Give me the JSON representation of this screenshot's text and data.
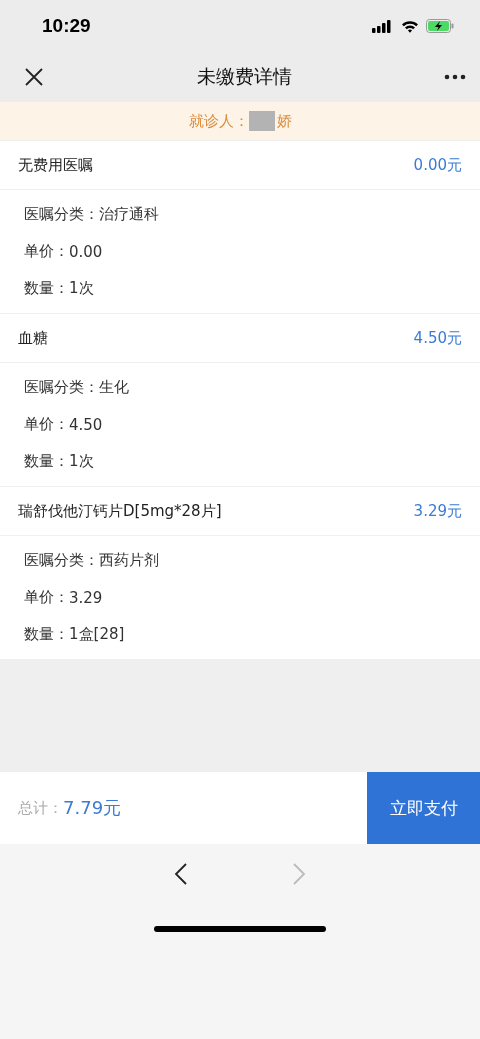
{
  "status_bar": {
    "time": "10:29"
  },
  "nav": {
    "title": "未缴费详情"
  },
  "patient": {
    "label": "就诊人：",
    "name": "娇"
  },
  "items": [
    {
      "name": "无费用医嘱",
      "amount": "0.00元",
      "details": [
        {
          "label": "医嘱分类：",
          "value": "治疗通科"
        },
        {
          "label": "单价：",
          "value": "0.00"
        },
        {
          "label": "数量：",
          "value": "1次"
        }
      ]
    },
    {
      "name": "血糖",
      "amount": "4.50元",
      "details": [
        {
          "label": "医嘱分类：",
          "value": "生化"
        },
        {
          "label": "单价：",
          "value": "4.50"
        },
        {
          "label": "数量：",
          "value": "1次"
        }
      ]
    },
    {
      "name": "瑞舒伐他汀钙片D[5mg*28片]",
      "amount": "3.29元",
      "details": [
        {
          "label": "医嘱分类：",
          "value": "西药片剂"
        },
        {
          "label": "单价：",
          "value": "3.29"
        },
        {
          "label": "数量：",
          "value": "1盒[28]"
        }
      ]
    }
  ],
  "footer": {
    "total_label": "总计：",
    "total": "7.79元",
    "pay_button": "立即支付"
  },
  "browser_nav": {
    "back": {
      "disabled": false
    },
    "forward": {
      "disabled": true
    }
  }
}
